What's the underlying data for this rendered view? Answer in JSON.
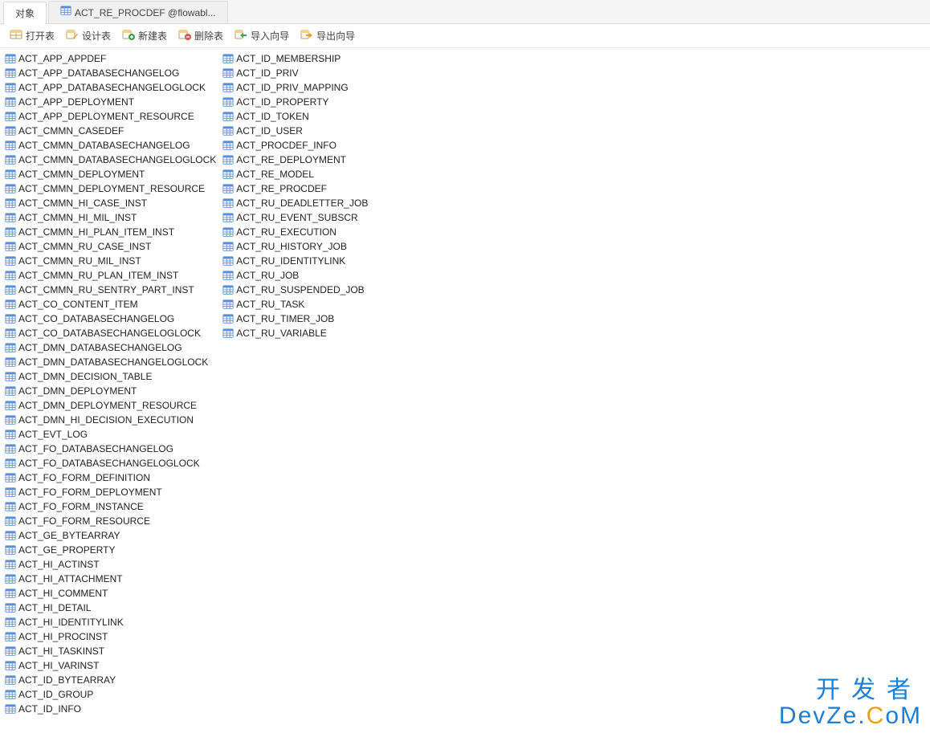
{
  "tabs": {
    "objects": "对象",
    "other": "ACT_RE_PROCDEF @flowabl..."
  },
  "toolbar": {
    "open_table": "打开表",
    "design_table": "设计表",
    "new_table": "新建表",
    "delete_table": "删除表",
    "import_wizard": "导入向导",
    "export_wizard": "导出向导"
  },
  "tables": {
    "col1": [
      "ACT_APP_APPDEF",
      "ACT_APP_DATABASECHANGELOG",
      "ACT_APP_DATABASECHANGELOGLOCK",
      "ACT_APP_DEPLOYMENT",
      "ACT_APP_DEPLOYMENT_RESOURCE",
      "ACT_CMMN_CASEDEF",
      "ACT_CMMN_DATABASECHANGELOG",
      "ACT_CMMN_DATABASECHANGELOGLOCK",
      "ACT_CMMN_DEPLOYMENT",
      "ACT_CMMN_DEPLOYMENT_RESOURCE",
      "ACT_CMMN_HI_CASE_INST",
      "ACT_CMMN_HI_MIL_INST",
      "ACT_CMMN_HI_PLAN_ITEM_INST",
      "ACT_CMMN_RU_CASE_INST",
      "ACT_CMMN_RU_MIL_INST",
      "ACT_CMMN_RU_PLAN_ITEM_INST",
      "ACT_CMMN_RU_SENTRY_PART_INST",
      "ACT_CO_CONTENT_ITEM",
      "ACT_CO_DATABASECHANGELOG",
      "ACT_CO_DATABASECHANGELOGLOCK",
      "ACT_DMN_DATABASECHANGELOG",
      "ACT_DMN_DATABASECHANGELOGLOCK",
      "ACT_DMN_DECISION_TABLE",
      "ACT_DMN_DEPLOYMENT",
      "ACT_DMN_DEPLOYMENT_RESOURCE",
      "ACT_DMN_HI_DECISION_EXECUTION",
      "ACT_EVT_LOG",
      "ACT_FO_DATABASECHANGELOG",
      "ACT_FO_DATABASECHANGELOGLOCK",
      "ACT_FO_FORM_DEFINITION",
      "ACT_FO_FORM_DEPLOYMENT",
      "ACT_FO_FORM_INSTANCE",
      "ACT_FO_FORM_RESOURCE",
      "ACT_GE_BYTEARRAY",
      "ACT_GE_PROPERTY",
      "ACT_HI_ACTINST",
      "ACT_HI_ATTACHMENT",
      "ACT_HI_COMMENT",
      "ACT_HI_DETAIL",
      "ACT_HI_IDENTITYLINK",
      "ACT_HI_PROCINST",
      "ACT_HI_TASKINST",
      "ACT_HI_VARINST",
      "ACT_ID_BYTEARRAY",
      "ACT_ID_GROUP",
      "ACT_ID_INFO"
    ],
    "col2": [
      "ACT_ID_MEMBERSHIP",
      "ACT_ID_PRIV",
      "ACT_ID_PRIV_MAPPING",
      "ACT_ID_PROPERTY",
      "ACT_ID_TOKEN",
      "ACT_ID_USER",
      "ACT_PROCDEF_INFO",
      "ACT_RE_DEPLOYMENT",
      "ACT_RE_MODEL",
      "ACT_RE_PROCDEF",
      "ACT_RU_DEADLETTER_JOB",
      "ACT_RU_EVENT_SUBSCR",
      "ACT_RU_EXECUTION",
      "ACT_RU_HISTORY_JOB",
      "ACT_RU_IDENTITYLINK",
      "ACT_RU_JOB",
      "ACT_RU_SUSPENDED_JOB",
      "ACT_RU_TASK",
      "ACT_RU_TIMER_JOB",
      "ACT_RU_VARIABLE"
    ]
  },
  "watermark": {
    "line1": "开发者",
    "line2": "DevZe.CoM"
  },
  "colors": {
    "icon_blue": "#5a8fd6",
    "icon_green": "#3fa14a",
    "icon_red": "#d9534f",
    "icon_orange": "#f39c12",
    "brand_blue": "#1b7fd6"
  }
}
